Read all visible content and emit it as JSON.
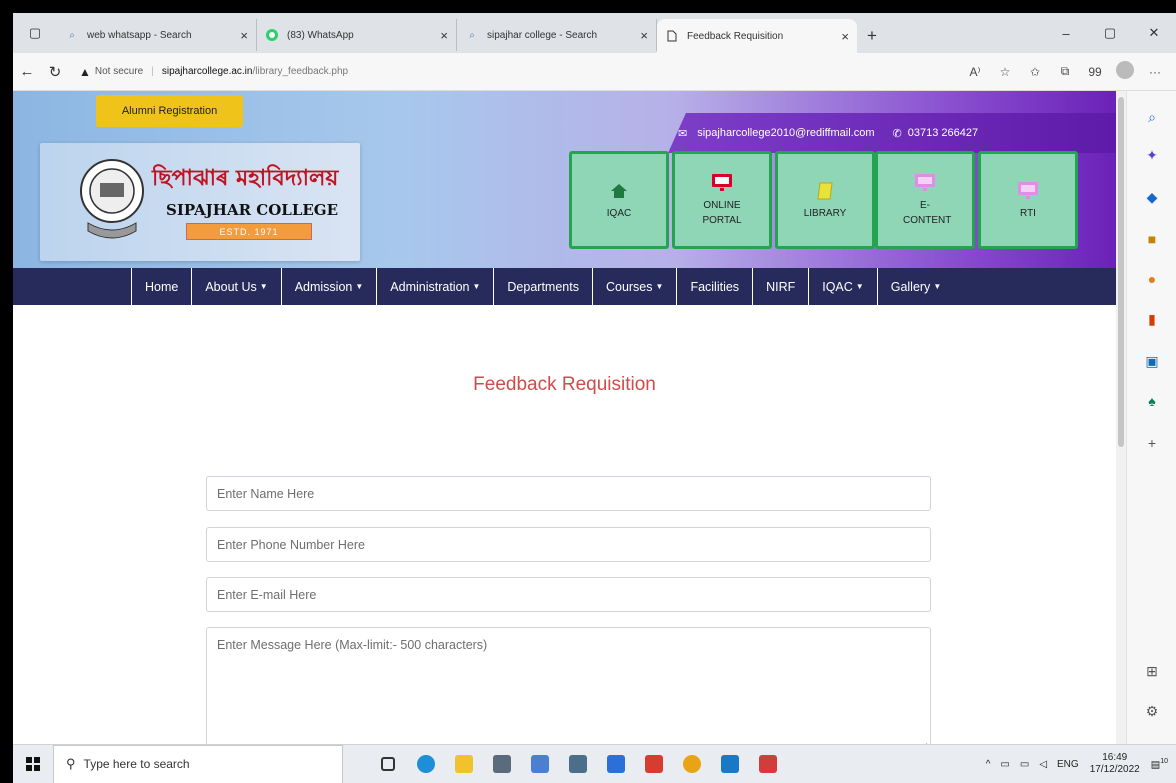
{
  "browser": {
    "tabs": [
      {
        "title": "web whatsapp - Search",
        "icon": "search-icon"
      },
      {
        "title": "(83) WhatsApp",
        "icon": "whatsapp-icon"
      },
      {
        "title": "sipajhar college - Search",
        "icon": "search-icon"
      },
      {
        "title": "Feedback Requisition",
        "icon": "page-icon"
      }
    ],
    "new_tab": "+",
    "window": {
      "minimize": "–",
      "restore": "▢",
      "close": "✕"
    },
    "address": {
      "not_secure": "Not secure",
      "host": "sipajharcollege.ac.in",
      "path": "/library_feedback.php"
    },
    "toolbar_glyphs": {
      "read_aloud": "A⁾",
      "favorite": "☆",
      "favorites_bar": "✩",
      "collections": "⧉",
      "extension": "99",
      "more": "···"
    }
  },
  "site": {
    "alumni_button": "Alumni Registration",
    "email": "sipajharcollege2010@rediffmail.com",
    "phone": "03713 266427",
    "logo_bengali": "ছিপাঝাৰ মহাবিদ্যালয়",
    "logo_name": "SIPAJHAR COLLEGE",
    "logo_estd": "ESTD. 1971",
    "quick_links": [
      {
        "label": "IQAC",
        "icon": "home-icon"
      },
      {
        "label": "ONLINE PORTAL",
        "icon": "monitor-icon"
      },
      {
        "label": "LIBRARY",
        "icon": "book-icon"
      },
      {
        "label": "E-CONTENT",
        "icon": "monitor-icon"
      },
      {
        "label": "RTI",
        "icon": "monitor-icon"
      }
    ],
    "nav": [
      {
        "label": "Home",
        "dropdown": false
      },
      {
        "label": "About Us",
        "dropdown": true
      },
      {
        "label": "Admission",
        "dropdown": true
      },
      {
        "label": "Administration",
        "dropdown": true
      },
      {
        "label": "Departments",
        "dropdown": false
      },
      {
        "label": "Courses",
        "dropdown": true
      },
      {
        "label": "Facilities",
        "dropdown": false
      },
      {
        "label": "NIRF",
        "dropdown": false
      },
      {
        "label": "IQAC",
        "dropdown": true
      },
      {
        "label": "Gallery",
        "dropdown": true
      }
    ],
    "caret": "▼"
  },
  "form": {
    "title": "Feedback Requisition",
    "name_placeholder": "Enter Name Here",
    "phone_placeholder": "Enter Phone Number Here",
    "email_placeholder": "Enter E-mail Here",
    "message_placeholder": "Enter Message Here (Max-limit:- 500 characters)"
  },
  "taskbar": {
    "search_placeholder": "Type here to search",
    "lang": "ENG",
    "time": "16:49",
    "date": "17/12/2022",
    "notifications": "10"
  },
  "colors": {
    "nav_bg": "#262b5b",
    "accent_red": "#d24a4a",
    "quick_bg": "#8fd6b7",
    "quick_border": "#22a54e",
    "alumni_bg": "#f0c31a"
  }
}
